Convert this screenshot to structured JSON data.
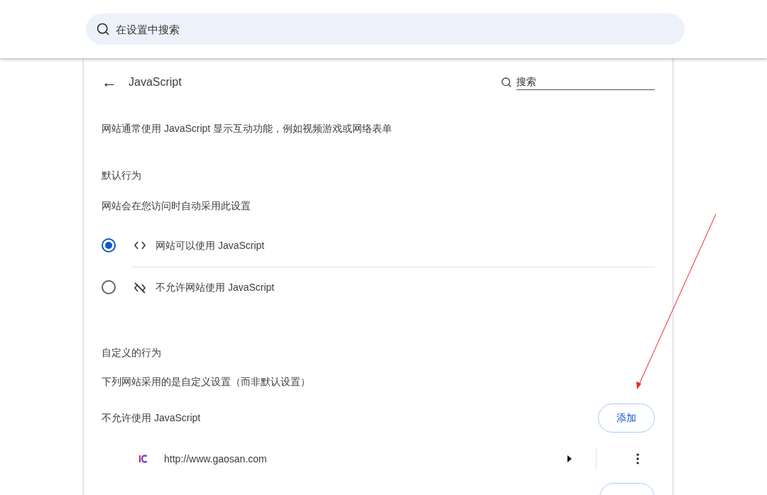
{
  "top_search": {
    "placeholder": "在设置中搜索"
  },
  "header": {
    "back": "←",
    "title": "JavaScript",
    "search": {
      "placeholder": "搜索"
    }
  },
  "description": "网站通常使用 JavaScript 显示互动功能，例如视频游戏或网络表单",
  "default_behavior": {
    "heading": "默认行为",
    "subtitle": "网站会在您访问时自动采用此设置",
    "options": [
      {
        "label": "网站可以使用 JavaScript",
        "kind": "allow",
        "selected": true
      },
      {
        "label": "不允许网站使用 JavaScript",
        "kind": "block",
        "selected": false
      }
    ]
  },
  "custom_behavior": {
    "heading": "自定义的行为",
    "subtitle": "下列网站采用的是自定义设置（而非默认设置）",
    "section": {
      "title": "不允许使用 JavaScript",
      "add_button": "添加",
      "sites": [
        {
          "url": "http://www.gaosan.com"
        }
      ]
    }
  }
}
